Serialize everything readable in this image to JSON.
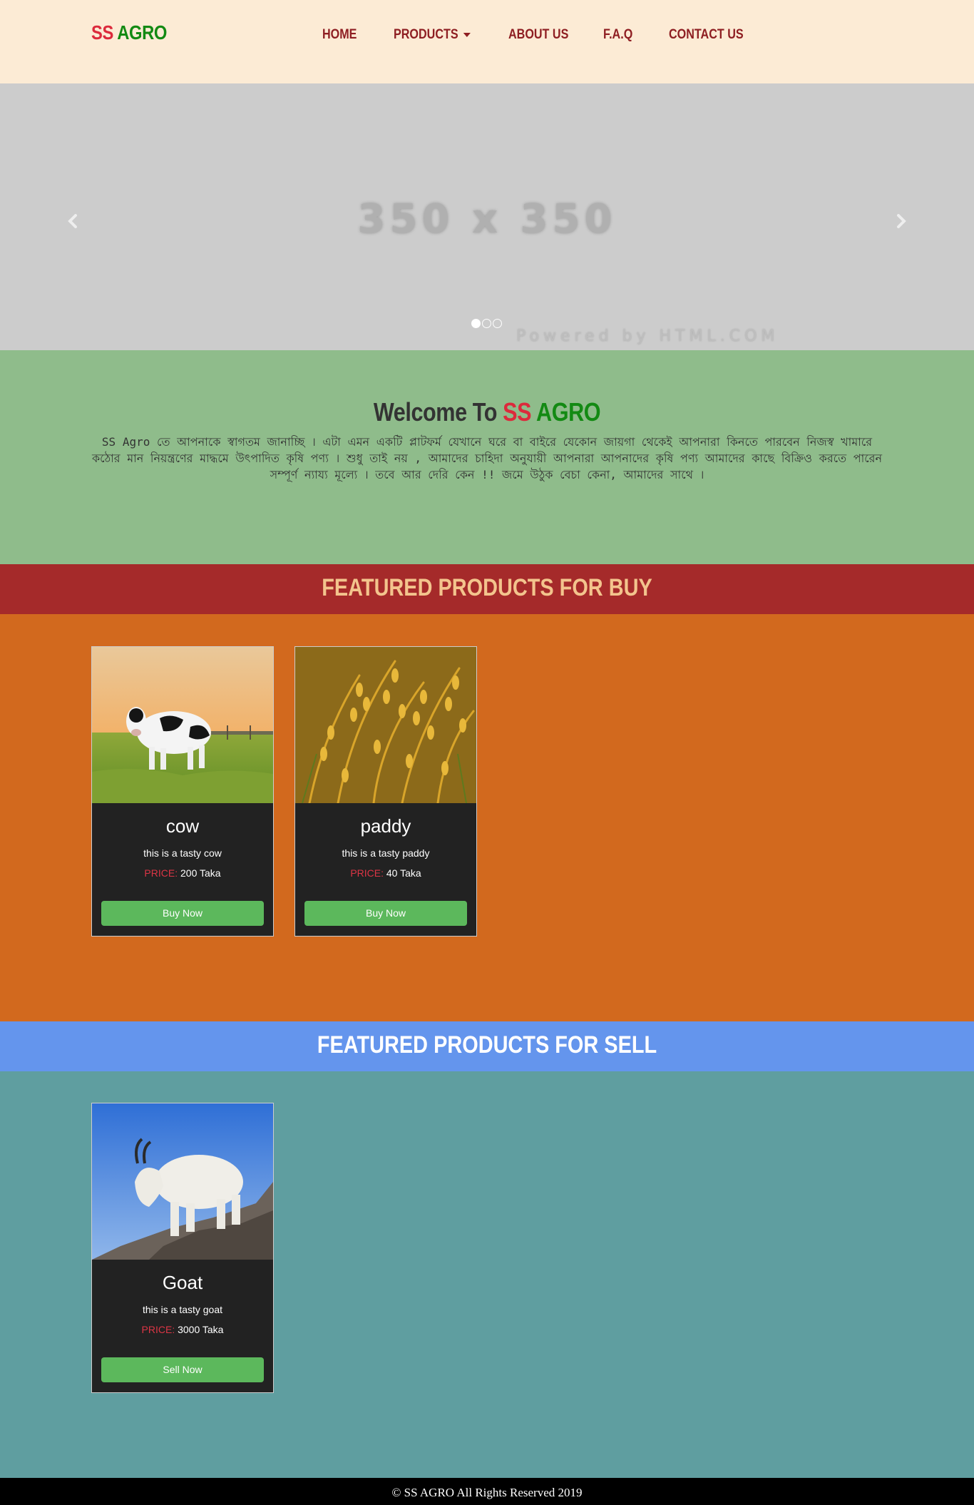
{
  "navbar": {
    "brand_ss": "SS",
    "brand_agro": "AGRO",
    "items": [
      {
        "label": "HOME"
      },
      {
        "label": "PRODUCTS"
      },
      {
        "label": "ABOUT US"
      },
      {
        "label": "F.A.Q"
      },
      {
        "label": "CONTACT US"
      }
    ]
  },
  "carousel": {
    "placeholder": "350 x 350",
    "powered": "Powered by HTML.COM",
    "prev_icon": "chevron-left-icon",
    "next_icon": "chevron-right-icon",
    "slide_count": 3,
    "active_slide": 1
  },
  "welcome": {
    "title_prefix": "Welcome To",
    "title_ss": "SS",
    "title_agro": "AGRO",
    "text": "SS Agro তে আপনাকে স্বাগতম জানাচ্ছি । এটা এমন একটি প্লাটফর্ম যেখানে ঘরে বা বাইরে যেকোন জায়গা থেকেই আপনারা কিনতে পারবেন নিজস্ব খামারে কঠোর মান নিয়ন্ত্রণের মাদ্ধমে উৎপাদিত কৃষি পণ্য । শুধু তাই নয় , আমাদের চাহিদা অনুযায়ী আপনারা আপনাদের কৃষি পণ্য আমাদের কাছে বিক্রিও করতে পারেন সম্পূর্ণ ন্যায্য মূল্যে । তবে আর দেরি কেন !! জমে উঠুক বেচা কেনা, আমাদের সাথে ।"
  },
  "buy_section": {
    "title": "FEATURED PRODUCTS FOR BUY",
    "products": [
      {
        "name": "cow",
        "desc": "this is a tasty cow",
        "price_label": "PRICE:",
        "price": "200 Taka",
        "button": "Buy Now"
      },
      {
        "name": "paddy",
        "desc": "this is a tasty paddy",
        "price_label": "PRICE:",
        "price": "40 Taka",
        "button": "Buy Now"
      }
    ]
  },
  "sell_section": {
    "title": "FEATURED PRODUCTS FOR SELL",
    "products": [
      {
        "name": "Goat",
        "desc": "this is a tasty goat",
        "price_label": "PRICE:",
        "price": "3000 Taka",
        "button": "Sell Now"
      }
    ]
  },
  "footer": {
    "text": "© SS AGRO All Rights Reserved 2019"
  },
  "colors": {
    "nav_bg": "#FCEBD5",
    "brand_red": "#DC2A3C",
    "brand_green": "#138A13",
    "nav_link": "#8E1E22",
    "welcome_bg": "#8FBC8B",
    "buy_header_bg": "#A52A2A",
    "buy_area_bg": "#D2691E",
    "sell_header_bg": "#6495ED",
    "sell_area_bg": "#5F9EA0",
    "button_green": "#5CB85C"
  }
}
